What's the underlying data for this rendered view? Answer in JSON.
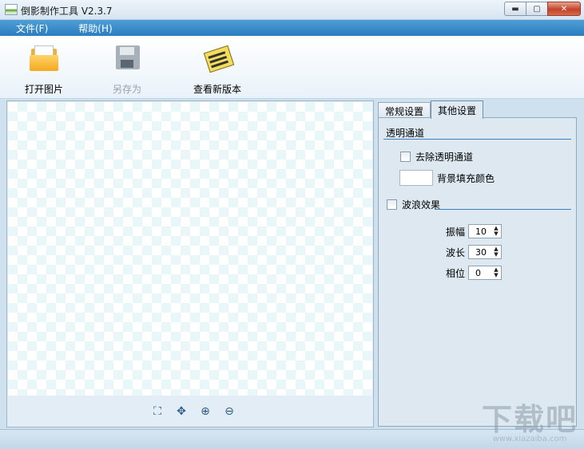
{
  "window": {
    "title": "倒影制作工具 V2.3.7",
    "minimize_glyph": "▬",
    "maximize_glyph": "▢",
    "close_glyph": "✕"
  },
  "menu": [
    {
      "label": "文件(F)"
    },
    {
      "label": "帮助(H)"
    }
  ],
  "toolbar": {
    "open_label": "打开图片",
    "saveas_label": "另存为",
    "update_label": "查看新版本",
    "icons": [
      "folder-icon",
      "floppy-disk-icon",
      "newspaper-icon"
    ]
  },
  "zoom_toolbar": {
    "glyphs": [
      "⛶",
      "✥",
      "⊕",
      "⊖"
    ],
    "icons": [
      "fit-to-window-icon",
      "actual-size-icon",
      "zoom-in-icon",
      "zoom-out-icon"
    ]
  },
  "tabs": [
    {
      "label": "常规设置",
      "active": false
    },
    {
      "label": "其他设置",
      "active": true
    }
  ],
  "settings": {
    "transparency_title": "透明通道",
    "remove_alpha_label": "去除透明通道",
    "remove_alpha_checked": false,
    "bg_fill_label": "背景填充颜色",
    "bg_fill_color": "#ffffff",
    "wave_label": "波浪效果",
    "wave_checked": false,
    "params": [
      {
        "label": "振幅",
        "value": "10"
      },
      {
        "label": "波长",
        "value": "30"
      },
      {
        "label": "相位",
        "value": "0"
      }
    ]
  },
  "watermark": {
    "big": "下载吧",
    "small": "www.xiazaiba.com"
  },
  "colors": {
    "menubar": "#2b7dc0",
    "checker": "#e9f7f9",
    "close_button": "#c2442a"
  }
}
